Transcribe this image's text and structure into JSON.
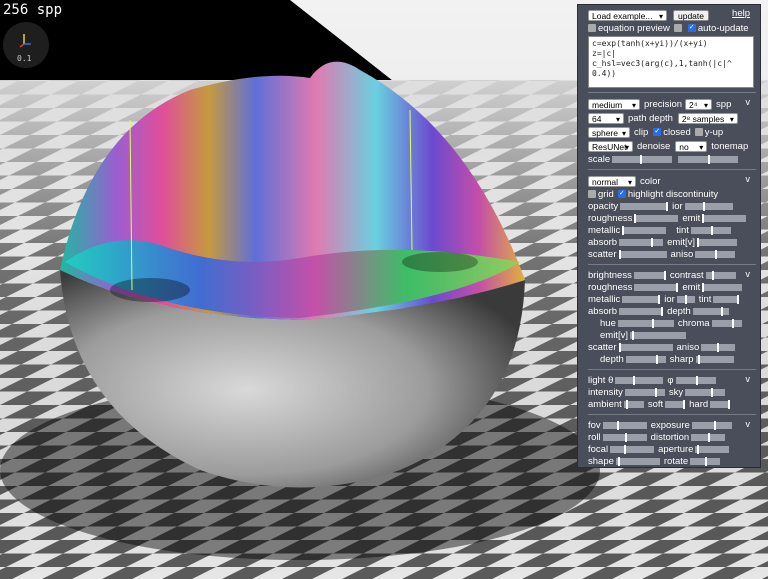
{
  "hud": {
    "spp_text": "256 spp",
    "gizmo_scale": "0.1"
  },
  "panel": {
    "load_example": "Load example...",
    "update": "update",
    "help": "help",
    "equation_preview": "equation preview",
    "auto_update": "auto-update",
    "equation": "c=exp(tanh(x+yi))/(x+yi)\nz=|c|\nc_hsl=vec3(arg(c),1,tanh(|c|^\n0.4))",
    "render": {
      "precision_value": "medium",
      "precision_label": "precision",
      "spp_value": "2⁴",
      "spp_label": "spp",
      "depth_value": "64",
      "depth_label": "path depth",
      "samples_value": "2⁸ samples",
      "clip_value": "sphere",
      "clip_label": "clip",
      "closed_label": "closed",
      "yup_label": "y-up",
      "denoise_value": "ResUNet",
      "denoise_label": "denoise",
      "tonemap_value": "no",
      "tonemap_label": "tonemap",
      "scale_label": "scale",
      "caret": "v"
    },
    "material": {
      "color_mode": "normal",
      "color_label": "color",
      "grid_label": "grid",
      "highlight_label": "highlight discontinuity",
      "opacity": "opacity",
      "ior": "ior",
      "roughness": "roughness",
      "emit": "emit",
      "metallic": "metallic",
      "tint": "tint",
      "absorb": "absorb",
      "emitv": "emit[v]",
      "scatter": "scatter",
      "aniso": "aniso",
      "caret": "v"
    },
    "env": {
      "brightness": "brightness",
      "contrast": "contrast",
      "roughness": "roughness",
      "emit": "emit",
      "metallic": "metallic",
      "ior": "ior",
      "tint": "tint",
      "absorb": "absorb",
      "depth": "depth",
      "hue": "hue",
      "chroma": "chroma",
      "emitv": "emit[v]",
      "scatter": "scatter",
      "aniso": "aniso",
      "depth2": "depth",
      "sharp": "sharp",
      "caret": "v"
    },
    "light": {
      "theta": "light θ",
      "phi": "φ",
      "intensity": "intensity",
      "sky": "sky",
      "ambient": "ambient",
      "soft": "soft",
      "hard": "hard",
      "caret": "v"
    },
    "camera": {
      "fov": "fov",
      "exposure": "exposure",
      "roll": "roll",
      "distortion": "distortion",
      "focal": "focal",
      "aperture": "aperture",
      "shape": "shape",
      "rotate": "rotate",
      "caret": "v"
    }
  }
}
